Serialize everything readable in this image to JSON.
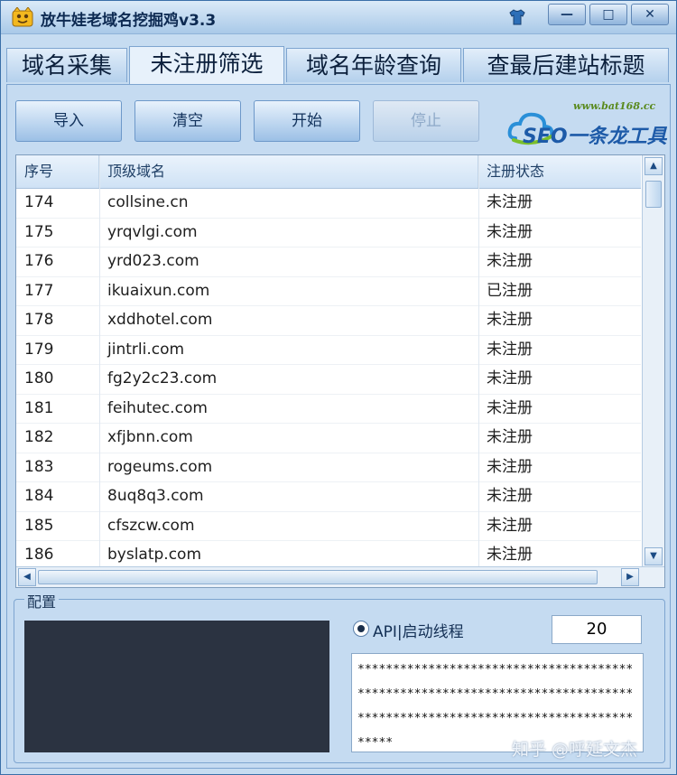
{
  "window": {
    "title": "放牛娃老域名挖掘鸡v3.3",
    "controls": {
      "minimize": "—",
      "maximize": "□",
      "close": "✕"
    }
  },
  "tabs": [
    {
      "label": "域名采集",
      "active": false
    },
    {
      "label": "未注册筛选",
      "active": true
    },
    {
      "label": "域名年龄查询",
      "active": false
    },
    {
      "label": "查最后建站标题",
      "active": false
    }
  ],
  "toolbar": {
    "import": "导入",
    "clear": "清空",
    "start": "开始",
    "stop": "停止"
  },
  "logo": {
    "url": "www.bat168.cc",
    "text": "SEO一条龙工具"
  },
  "table": {
    "columns": [
      "序号",
      "顶级域名",
      "注册状态"
    ],
    "rows": [
      [
        "174",
        "collsine.cn",
        "未注册"
      ],
      [
        "175",
        "yrqvlgi.com",
        "未注册"
      ],
      [
        "176",
        "yrd023.com",
        "未注册"
      ],
      [
        "177",
        "ikuaixun.com",
        "已注册"
      ],
      [
        "178",
        "xddhotel.com",
        "未注册"
      ],
      [
        "179",
        "jintrli.com",
        "未注册"
      ],
      [
        "180",
        "fg2y2c23.com",
        "未注册"
      ],
      [
        "181",
        "feihutec.com",
        "未注册"
      ],
      [
        "182",
        "xfjbnn.com",
        "未注册"
      ],
      [
        "183",
        "rogeums.com",
        "未注册"
      ],
      [
        "184",
        "8uq8q3.com",
        "未注册"
      ],
      [
        "185",
        "cfszcw.com",
        "未注册"
      ],
      [
        "186",
        "byslatp.com",
        "未注册"
      ]
    ]
  },
  "config": {
    "label": "配置",
    "api_option": "API|启动线程",
    "threads": "20",
    "key": "**************************************************************************************************************************"
  },
  "watermark": "知乎 @呼延文杰",
  "colors": {
    "window_bg": "#c6dcf1",
    "title": "#0d2a52",
    "dark_panel": "#2b3341"
  }
}
